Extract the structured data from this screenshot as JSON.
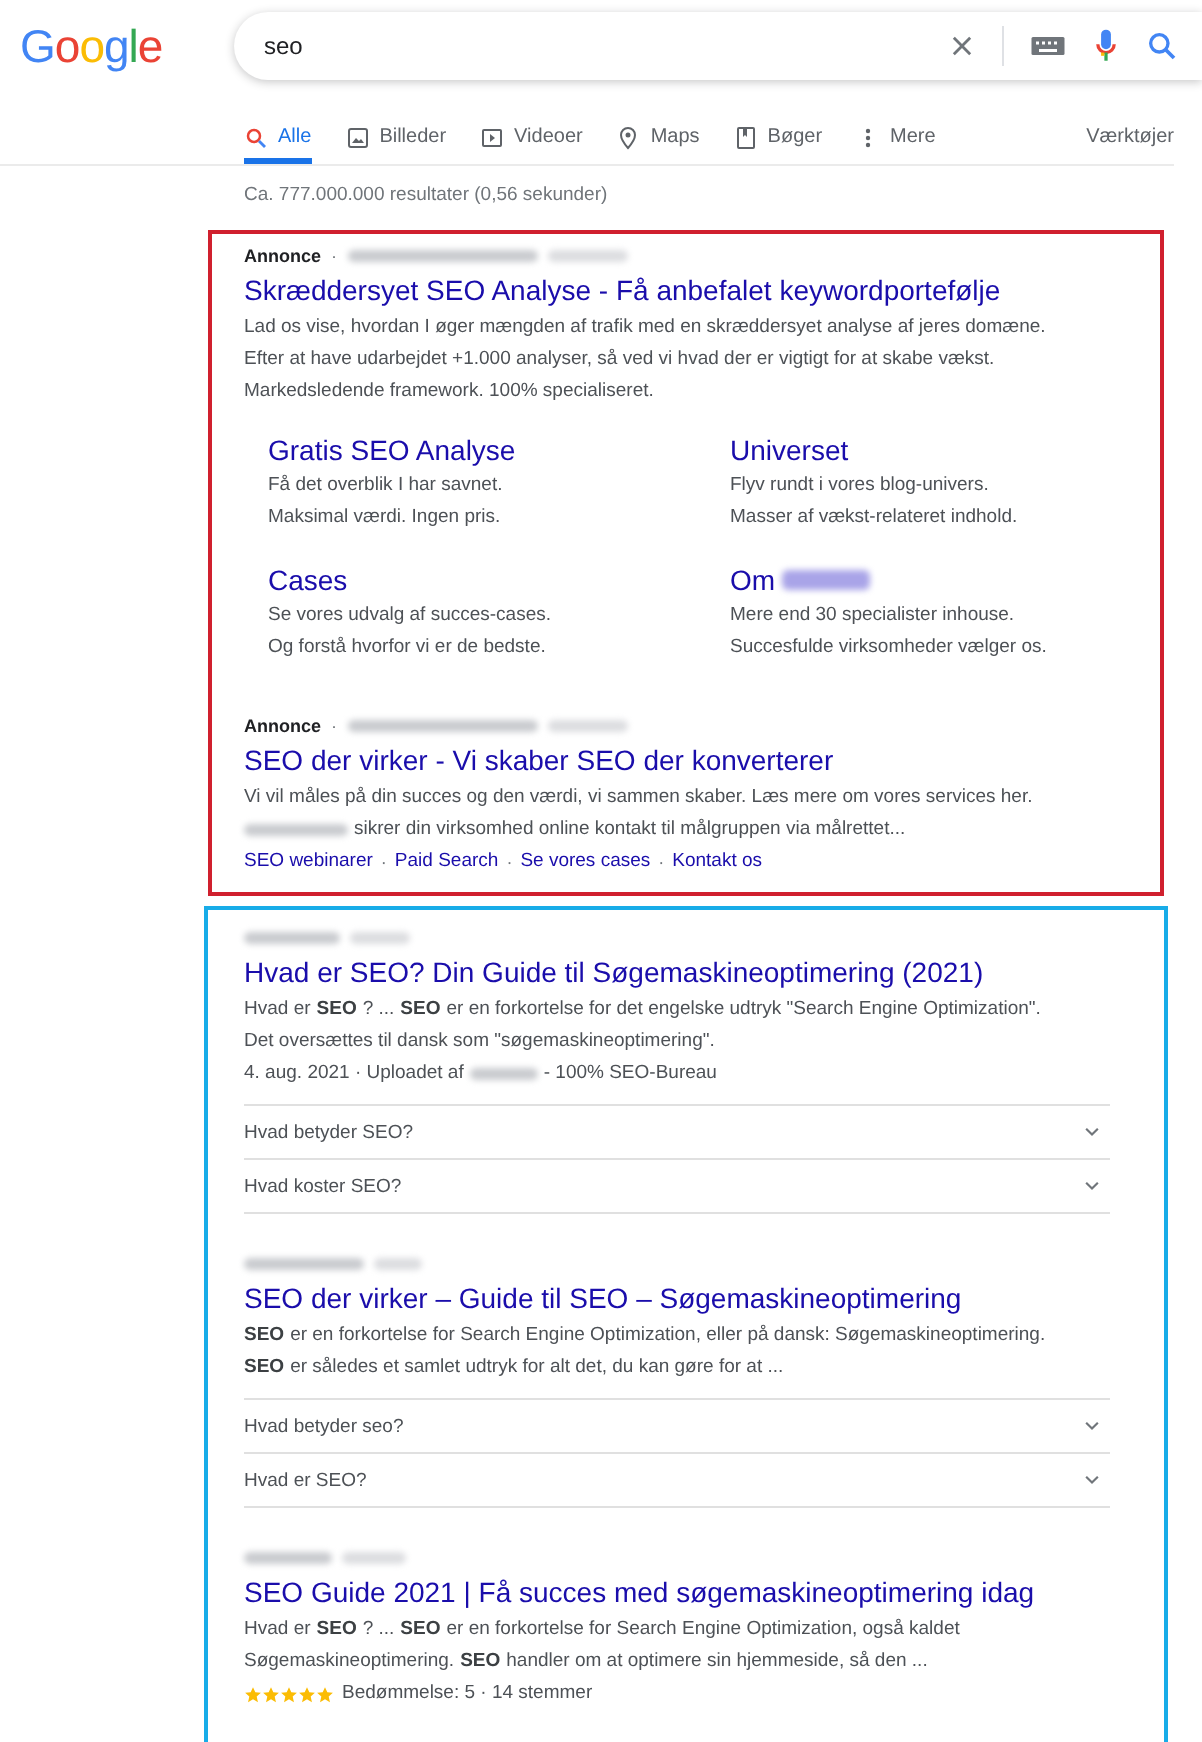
{
  "logo": "Google",
  "search": {
    "value": "seo"
  },
  "tabs": [
    {
      "label": "Alle",
      "kind": "search",
      "selected": true
    },
    {
      "label": "Billeder",
      "kind": "image",
      "selected": false
    },
    {
      "label": "Videoer",
      "kind": "video",
      "selected": false
    },
    {
      "label": "Maps",
      "kind": "pin",
      "selected": false
    },
    {
      "label": "Bøger",
      "kind": "book",
      "selected": false
    },
    {
      "label": "Mere",
      "kind": "dots",
      "selected": false
    }
  ],
  "separator": "·",
  "tools": "Værktøjer",
  "result_stats": "Ca. 777.000.000 resultater (0,56 sekunder)",
  "ads": [
    {
      "label": "Annonce",
      "title": "Skræddersyet SEO Analyse - Få anbefalet keywordportefølje",
      "description": [
        {
          "text": "Lad os vise, hvordan I øger mængden af trafik med en skræddersyet analyse af jeres domæne.",
          "redacted_prefix": false
        },
        {
          "text": "Efter at have udarbejdet +1.000 analyser, så ved vi hvad der er vigtigt for at skabe vækst.",
          "redacted_prefix": false
        },
        {
          "text": "Markedsledende framework. 100% specialiseret.",
          "redacted_prefix": false
        }
      ],
      "sitelinks": [
        {
          "title": "Gratis SEO Analyse",
          "redacted_suffix": false,
          "lines": [
            "Få det overblik I har savnet.",
            "Maksimal værdi. Ingen pris."
          ]
        },
        {
          "title": "Universet",
          "redacted_suffix": false,
          "lines": [
            "Flyv rundt i vores blog-univers.",
            "Masser af vækst-relateret indhold."
          ]
        },
        {
          "title": "Cases",
          "redacted_suffix": false,
          "lines": [
            "Se vores udvalg af succes-cases.",
            "Og forstå hvorfor vi er de bedste."
          ]
        },
        {
          "title": "Om",
          "redacted_suffix": true,
          "lines": [
            "Mere end 30 specialister inhouse.",
            "Succesfulde virksomheder vælger os."
          ]
        }
      ]
    },
    {
      "label": "Annonce",
      "title": "SEO der virker - Vi skaber SEO der konverterer",
      "description": [
        {
          "text": "Vi vil måles på din succes og den værdi, vi sammen skaber. Læs mere om vores services her.",
          "redacted_prefix": false
        },
        {
          "text": "sikrer din virksomhed online kontakt til målgruppen via målrettet...",
          "redacted_prefix": true
        }
      ],
      "inline_links": [
        "SEO webinarer",
        "Paid Search",
        "Se vores cases",
        "Kontakt os"
      ]
    }
  ],
  "results": [
    {
      "title": "Hvad er SEO? Din Guide til Søgemaskineoptimering (2021)",
      "snippet": [
        "Hvad er **SEO**? ... **SEO** er en forkortelse for det engelske udtryk \"Search Engine Optimization\".",
        "Det oversættes til dansk som \"søgemaskineoptimering\"."
      ],
      "meta": {
        "before": "4. aug. 2021 · Uploadet af",
        "after": "- 100% SEO-Bureau"
      },
      "faqs": [
        {
          "question": "Hvad betyder SEO?",
          "expanded": false
        },
        {
          "question": "Hvad koster SEO?",
          "expanded": false
        }
      ]
    },
    {
      "title": "SEO der virker – Guide til SEO – Søgemaskineoptimering",
      "snippet": [
        "**SEO** er en forkortelse for Search Engine Optimization, eller på dansk: Søgemaskineoptimering.",
        "**SEO** er således et samlet udtryk for alt det, du kan gøre for at ..."
      ],
      "faqs": [
        {
          "question": "Hvad betyder seo?",
          "expanded": false
        },
        {
          "question": "Hvad er SEO?",
          "expanded": false
        }
      ]
    },
    {
      "title": "SEO Guide 2021 | Få succes med søgemaskineoptimering idag",
      "snippet": [
        "Hvad er **SEO**? ... **SEO** er en forkortelse for Search Engine Optimization, også kaldet",
        "Søgemaskineoptimering. **SEO** handler om at optimere sin hjemmeside, så den ..."
      ],
      "stars": 5,
      "rating": "Bedømmelse: 5 · 14 stemmer"
    }
  ]
}
